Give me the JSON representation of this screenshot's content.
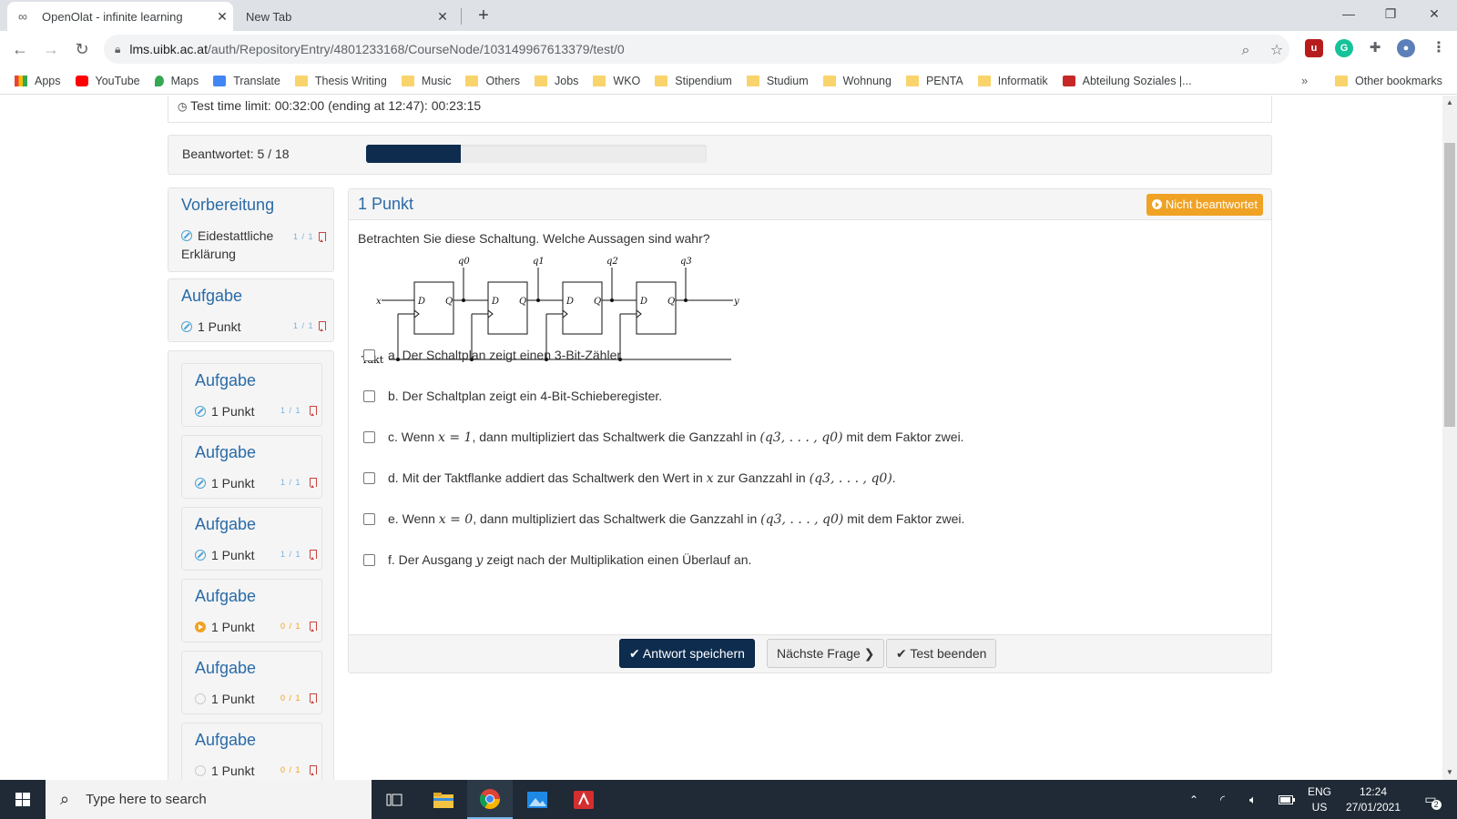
{
  "browser": {
    "tabs": [
      {
        "title": "OpenOlat - infinite learning",
        "active": true,
        "icon": "infinity-icon"
      },
      {
        "title": "New Tab",
        "active": false
      }
    ],
    "url_host": "lms.uibk.ac.at",
    "url_path": "/auth/RepositoryEntry/4801233168/CourseNode/103149967613379/test/0",
    "bookmarks": [
      "Apps",
      "YouTube",
      "Maps",
      "Translate",
      "Thesis Writing",
      "Music",
      "Others",
      "Jobs",
      "WKO",
      "Stipendium",
      "Studium",
      "Wohnung",
      "PENTA",
      "Informatik",
      "Abteilung Soziales |..."
    ],
    "bookmarks_more": "»",
    "other_bookmarks": "Other bookmarks"
  },
  "test": {
    "time_limit": "Test time limit: 00:32:00 (ending at 12:47): 00:23:15",
    "answered_label": "Beantwortet: 5 / 18",
    "answered": 5,
    "total": 18
  },
  "sidebar": {
    "sections": [
      {
        "title": "Vorbereitung",
        "item": {
          "label_line1": "Eidestattliche",
          "label_line2": "Erklärung",
          "score": "1 / 1",
          "status": "done"
        }
      },
      {
        "title": "Aufgabe",
        "item": {
          "label": "1 Punkt",
          "score": "1 / 1",
          "status": "done"
        }
      }
    ],
    "subcards": [
      {
        "title": "Aufgabe",
        "label": "1 Punkt",
        "score": "1 / 1",
        "status": "done"
      },
      {
        "title": "Aufgabe",
        "label": "1 Punkt",
        "score": "1 / 1",
        "status": "done"
      },
      {
        "title": "Aufgabe",
        "label": "1 Punkt",
        "score": "1 / 1",
        "status": "done"
      },
      {
        "title": "Aufgabe",
        "label": "1 Punkt",
        "score": "0 / 1",
        "status": "open"
      },
      {
        "title": "Aufgabe",
        "label": "1 Punkt",
        "score": "0 / 1",
        "status": "none"
      },
      {
        "title": "Aufgabe",
        "label": "1 Punkt",
        "score": "0 / 1",
        "status": "none"
      }
    ]
  },
  "question": {
    "title": "1 Punkt",
    "status": "Nicht beantwortet",
    "text": "Betrachten Sie diese Schaltung. Welche Aussagen sind wahr?",
    "circuit": {
      "x": "x",
      "y": "y",
      "clock": "Takt",
      "d": "D",
      "q": "Q",
      "outputs": [
        "q0",
        "q1",
        "q2",
        "q3"
      ]
    },
    "options": {
      "a": "a. Der Schaltplan zeigt einen 3-Bit-Zähler",
      "b": "b. Der Schaltplan zeigt ein 4-Bit-Schieberegister.",
      "c_pre": "c. Wenn ",
      "c_math": "x = 1",
      "c_mid": ", dann multipliziert das Schaltwerk die Ganzzahl in ",
      "c_tuple": "(q3, . . . , q0)",
      "c_post": " mit dem Faktor zwei.",
      "d_pre": "d. Mit der Taktflanke addiert das Schaltwerk den Wert in ",
      "d_math": "x",
      "d_mid": " zur Ganzzahl in ",
      "d_tuple": "(q3, . . . , q0)",
      "d_post": ".",
      "e_pre": "e. Wenn ",
      "e_math": "x = 0",
      "e_mid": ", dann multipliziert das Schaltwerk die Ganzzahl in ",
      "e_tuple": "(q3, . . . , q0)",
      "e_post": " mit dem Faktor zwei.",
      "f_pre": "f. Der Ausgang ",
      "f_math": "y",
      "f_post": " zeigt nach der Multiplikation einen Überlauf an."
    },
    "buttons": {
      "save": "Antwort speichern",
      "next": "Nächste Frage",
      "finish": "Test beenden"
    }
  },
  "taskbar": {
    "search_placeholder": "Type here to search",
    "lang": "ENG",
    "region": "US",
    "time": "12:24",
    "date": "27/01/2021",
    "notifications": "2"
  },
  "colors": {
    "accent": "#2a6ba8",
    "progress": "#0d2c4e",
    "warning": "#f0a224",
    "done": "#4ea3d4"
  }
}
